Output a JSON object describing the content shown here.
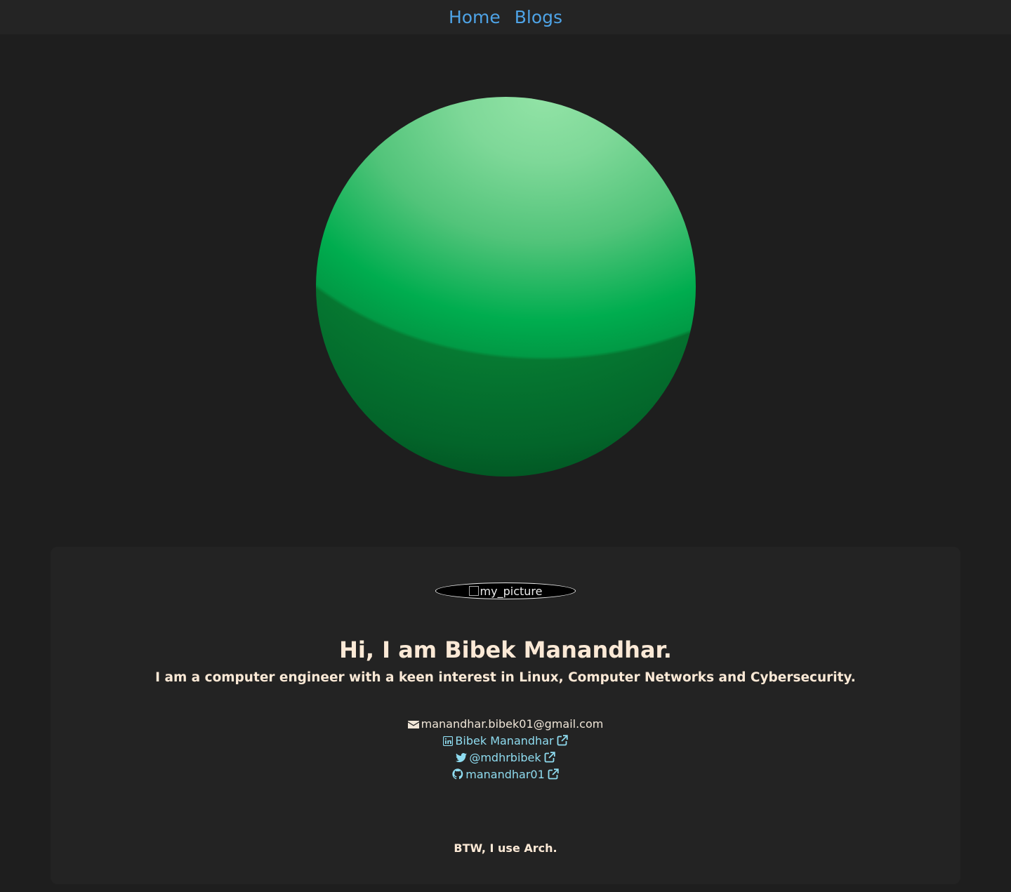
{
  "nav": {
    "items": [
      {
        "label": "Home"
      },
      {
        "label": "Blogs"
      }
    ],
    "link_color": "#4ea3e6"
  },
  "hero": {
    "sphere_colors": [
      "#92e3a6",
      "#00ad4f",
      "#014019"
    ]
  },
  "profile": {
    "avatar_alt": "my_picture",
    "title": "Hi, I am Bibek Manandhar.",
    "subtitle": "I am a computer engineer with a keen interest in Linux, Computer Networks and Cybersecurity.",
    "contacts": {
      "email": {
        "icon": "envelope-icon",
        "label": "manandhar.bibek01@gmail.com"
      },
      "linkedin": {
        "icon": "linkedin-icon",
        "label": "Bibek Manandhar"
      },
      "twitter": {
        "icon": "twitter-icon",
        "label": "@mdhrbibek"
      },
      "github": {
        "icon": "github-icon",
        "label": "manandhar01"
      }
    },
    "footer_note": "BTW, I use Arch."
  }
}
